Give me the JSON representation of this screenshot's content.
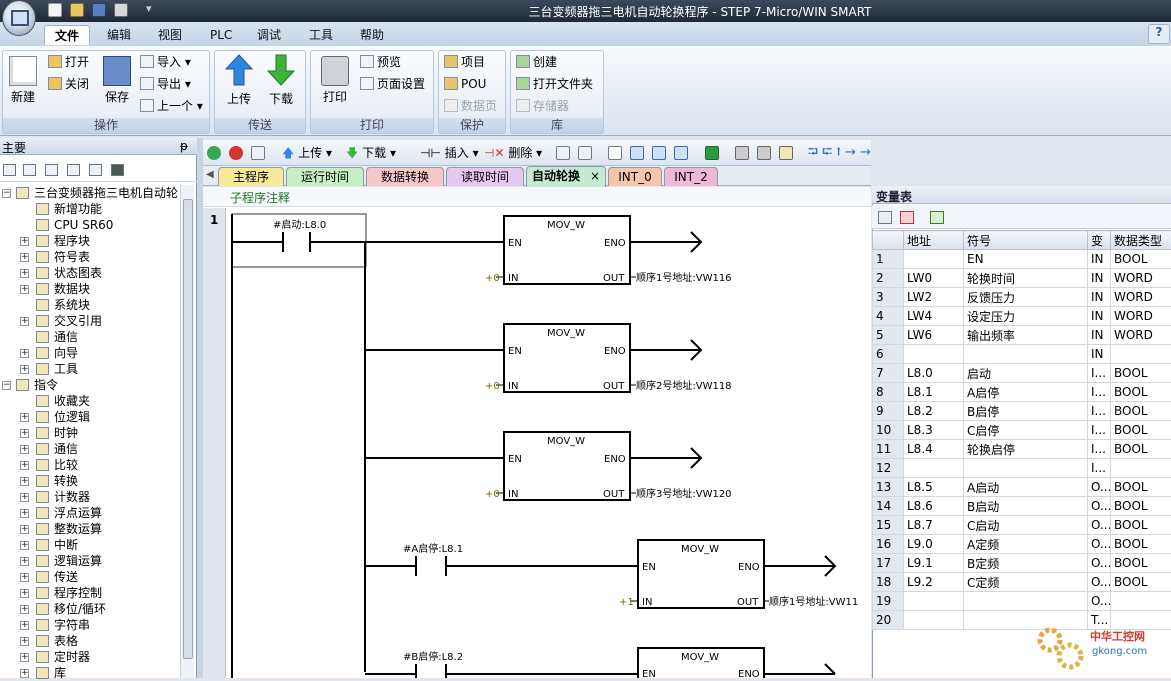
{
  "window": {
    "title": "三台变频器拖三电机自动轮换程序 - STEP 7-Micro/WIN SMART"
  },
  "menu": [
    "文件",
    "编辑",
    "视图",
    "PLC",
    "调试",
    "工具",
    "帮助"
  ],
  "help_badge": "?",
  "ribbon": {
    "groups": [
      {
        "label": "操作",
        "big": [
          "新建",
          "保存"
        ],
        "small": [
          "打开",
          "关闭",
          "导入",
          "导出",
          "上一个"
        ]
      },
      {
        "label": "传送",
        "big": [
          "上传",
          "下载"
        ]
      },
      {
        "label": "打印",
        "big": [
          "打印"
        ],
        "small": [
          "预览",
          "页面设置"
        ]
      },
      {
        "label": "保护",
        "small": [
          "项目",
          "POU",
          "数据页"
        ]
      },
      {
        "label": "库",
        "small": [
          "创建",
          "打开文件夹",
          "存储器"
        ]
      }
    ]
  },
  "left_panel": {
    "title": "主要",
    "pin": "ᵽ",
    "tree": [
      {
        "label": "三台变频器拖三电机自动轮",
        "level": 0,
        "exp": "−"
      },
      {
        "label": "新增功能",
        "level": 1
      },
      {
        "label": "CPU SR60",
        "level": 1
      },
      {
        "label": "程序块",
        "level": 1,
        "exp": "+"
      },
      {
        "label": "符号表",
        "level": 1,
        "exp": "+"
      },
      {
        "label": "状态图表",
        "level": 1,
        "exp": "+"
      },
      {
        "label": "数据块",
        "level": 1,
        "exp": "+"
      },
      {
        "label": "系统块",
        "level": 1
      },
      {
        "label": "交叉引用",
        "level": 1,
        "exp": "+"
      },
      {
        "label": "通信",
        "level": 1
      },
      {
        "label": "向导",
        "level": 1,
        "exp": "+"
      },
      {
        "label": "工具",
        "level": 1,
        "exp": "+"
      },
      {
        "label": "指令",
        "level": 0,
        "exp": "−"
      },
      {
        "label": "收藏夹",
        "level": 1
      },
      {
        "label": "位逻辑",
        "level": 1,
        "exp": "+"
      },
      {
        "label": "时钟",
        "level": 1,
        "exp": "+"
      },
      {
        "label": "通信",
        "level": 1,
        "exp": "+"
      },
      {
        "label": "比较",
        "level": 1,
        "exp": "+"
      },
      {
        "label": "转换",
        "level": 1,
        "exp": "+"
      },
      {
        "label": "计数器",
        "level": 1,
        "exp": "+"
      },
      {
        "label": "浮点运算",
        "level": 1,
        "exp": "+"
      },
      {
        "label": "整数运算",
        "level": 1,
        "exp": "+"
      },
      {
        "label": "中断",
        "level": 1,
        "exp": "+"
      },
      {
        "label": "逻辑运算",
        "level": 1,
        "exp": "+"
      },
      {
        "label": "传送",
        "level": 1,
        "exp": "+"
      },
      {
        "label": "程序控制",
        "level": 1,
        "exp": "+"
      },
      {
        "label": "移位/循环",
        "level": 1,
        "exp": "+"
      },
      {
        "label": "字符串",
        "level": 1,
        "exp": "+"
      },
      {
        "label": "表格",
        "level": 1,
        "exp": "+"
      },
      {
        "label": "定时器",
        "level": 1,
        "exp": "+"
      },
      {
        "label": "库",
        "level": 1,
        "exp": "+"
      }
    ]
  },
  "editor_toolbar": {
    "upload": "上传",
    "download": "下载",
    "insert": "插入",
    "delete": "删除"
  },
  "tabs": [
    {
      "label": "主程序",
      "color": "#f6ea9a"
    },
    {
      "label": "运行时间",
      "color": "#c8eec4"
    },
    {
      "label": "数据转换",
      "color": "#f7c6c8"
    },
    {
      "label": "读取时间",
      "color": "#e6c8ef"
    },
    {
      "label": "自动轮换",
      "color": "#c5ead2",
      "active": true
    },
    {
      "label": "INT_0",
      "color": "#f7c5a8"
    },
    {
      "label": "INT_2",
      "color": "#f0b8d7"
    }
  ],
  "tab_close": "×",
  "editor": {
    "comment": "子程序注释",
    "network_number": "1",
    "contacts": [
      {
        "label": "#启动:L8.0"
      },
      {
        "label": "#A启停:L8.1"
      },
      {
        "label": "#B启停:L8.2"
      }
    ],
    "blocks": [
      {
        "title": "MOV_W",
        "in_val": "+0",
        "out_label": "顺序1号地址:VW116"
      },
      {
        "title": "MOV_W",
        "in_val": "+0",
        "out_label": "顺序2号地址:VW118"
      },
      {
        "title": "MOV_W",
        "in_val": "+0",
        "out_label": "顺序3号地址:VW120"
      },
      {
        "title": "MOV_W",
        "in_val": "+1",
        "out_label": "顺序1号地址:VW11"
      },
      {
        "title": "MOV_W",
        "in_val": "",
        "out_label": ""
      }
    ],
    "pins": {
      "en": "EN",
      "eno": "ENO",
      "in": "IN",
      "out": "OUT"
    }
  },
  "var_table": {
    "title": "变量表",
    "headers": [
      "",
      "地址",
      "符号",
      "变",
      "数据类型"
    ],
    "rows": [
      [
        "1",
        "",
        "EN",
        "IN",
        "BOOL"
      ],
      [
        "2",
        "LW0",
        "轮换时间",
        "IN",
        "WORD"
      ],
      [
        "3",
        "LW2",
        "反馈压力",
        "IN",
        "WORD"
      ],
      [
        "4",
        "LW4",
        "设定压力",
        "IN",
        "WORD"
      ],
      [
        "5",
        "LW6",
        "输出频率",
        "IN",
        "WORD"
      ],
      [
        "6",
        "",
        "",
        "IN",
        ""
      ],
      [
        "7",
        "L8.0",
        "启动",
        "I...",
        "BOOL"
      ],
      [
        "8",
        "L8.1",
        "A启停",
        "I...",
        "BOOL"
      ],
      [
        "9",
        "L8.2",
        "B启停",
        "I...",
        "BOOL"
      ],
      [
        "10",
        "L8.3",
        "C启停",
        "I...",
        "BOOL"
      ],
      [
        "11",
        "L8.4",
        "轮换启停",
        "I...",
        "BOOL"
      ],
      [
        "12",
        "",
        "",
        "I...",
        ""
      ],
      [
        "13",
        "L8.5",
        "A启动",
        "O...",
        "BOOL"
      ],
      [
        "14",
        "L8.6",
        "B启动",
        "O...",
        "BOOL"
      ],
      [
        "15",
        "L8.7",
        "C启动",
        "O...",
        "BOOL"
      ],
      [
        "16",
        "L9.0",
        "A定频",
        "O...",
        "BOOL"
      ],
      [
        "17",
        "L9.1",
        "B定频",
        "O...",
        "BOOL"
      ],
      [
        "18",
        "L9.2",
        "C定频",
        "O...",
        "BOOL"
      ],
      [
        "19",
        "",
        "",
        "O...",
        ""
      ],
      [
        "20",
        "",
        "",
        "T...",
        ""
      ]
    ]
  },
  "watermark": {
    "line1": "中华工控网",
    "line2": "gkong.com"
  }
}
